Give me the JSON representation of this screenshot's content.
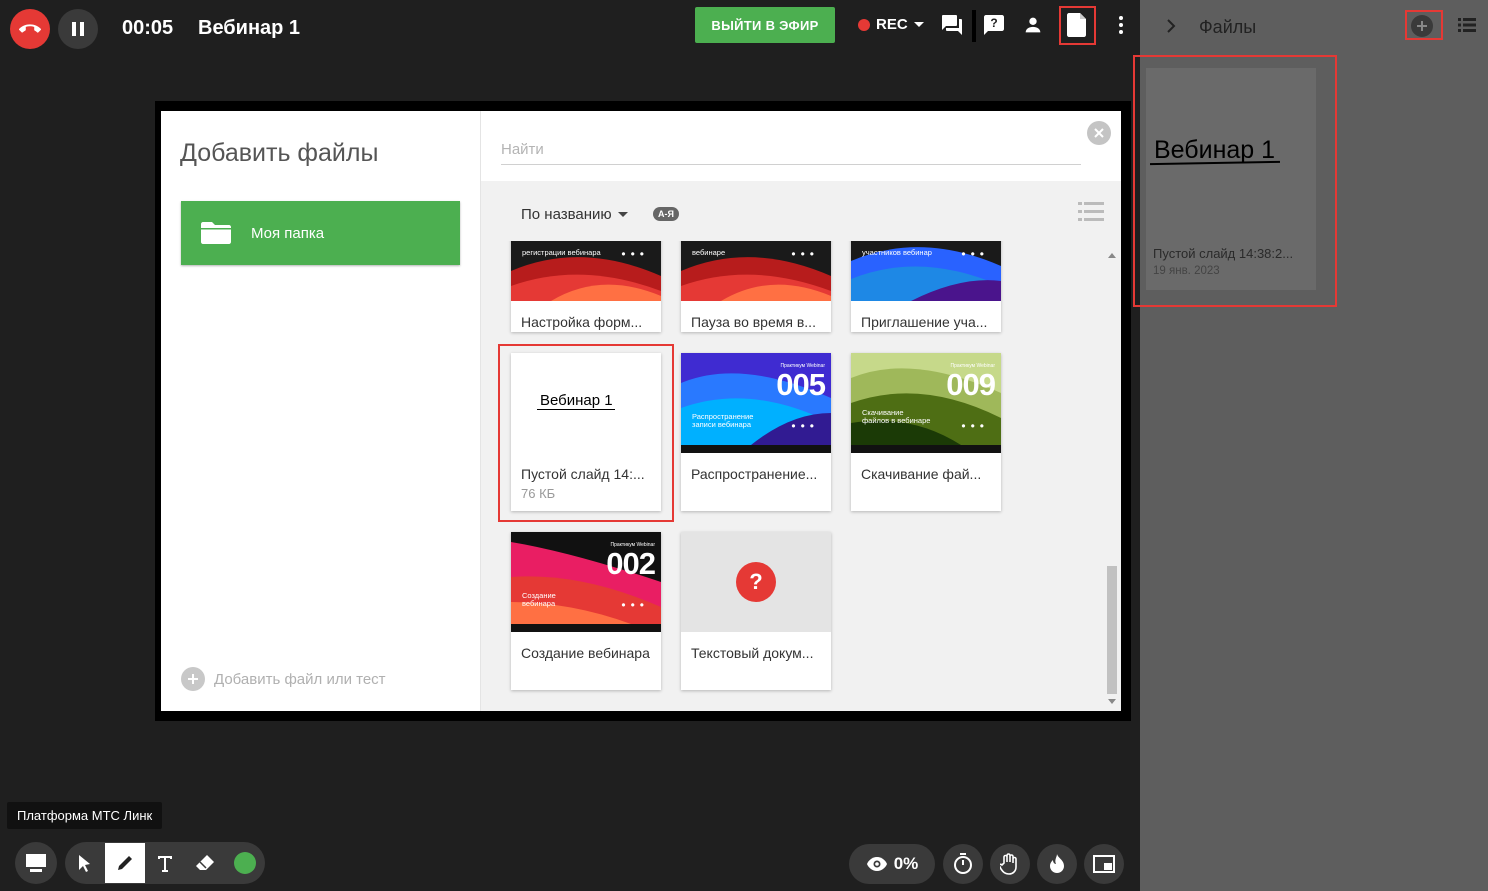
{
  "topbar": {
    "timer": "00:05",
    "title": "Вебинар 1",
    "onair_label": "ВЫЙТИ В ЭФИР",
    "rec_label": "REC",
    "icons": [
      "end-call-icon",
      "pause-icon",
      "chat-icon",
      "question-icon",
      "person-icon",
      "document-icon",
      "more-vert-icon"
    ]
  },
  "colors": {
    "accent_green": "#4caf50",
    "danger_red": "#e53935",
    "highlight_red": "#e53935"
  },
  "modal": {
    "title": "Добавить файлы",
    "folder_label": "Моя папка",
    "add_file_label": "Добавить файл или тест",
    "search_placeholder": "Найти",
    "sort_label": "По названию",
    "sort_badge": "А-Я",
    "files": [
      {
        "name": "Настройка форм...",
        "size": ""
      },
      {
        "name": "Пауза во время в...",
        "size": ""
      },
      {
        "name": "Приглашение уча...",
        "size": ""
      },
      {
        "name": "Пустой слайд 14:...",
        "size": "76 КБ",
        "thumb_title": "Вебинар 1"
      },
      {
        "name": "Распространение...",
        "size": "",
        "thumb_num": "005",
        "thumb_sub": "Распространение записи вебинара",
        "thumb_brand": "Практикум Webinar"
      },
      {
        "name": "Скачивание фай...",
        "size": "",
        "thumb_num": "009",
        "thumb_sub": "Скачивание файлов в вебинаре",
        "thumb_brand": "Практикум Webinar"
      },
      {
        "name": "Создание вебинара",
        "size": "",
        "thumb_num": "002",
        "thumb_sub": "Создание вебинара",
        "thumb_brand": "Практикум Webinar"
      },
      {
        "name": "Текстовый докум...",
        "size": "",
        "thumb_icon": "?"
      }
    ],
    "top_partial_captions": [
      "регистрации вебинара",
      "вебинаре",
      "участников вебинар"
    ]
  },
  "right_panel": {
    "title": "Файлы",
    "card_title": "Вебинар 1",
    "card_name": "Пустой слайд 14:38:2...",
    "card_date": "19 янв. 2023"
  },
  "tooltip": "Платформа МТС Линк",
  "bottom": {
    "participants_percent": "0%"
  }
}
